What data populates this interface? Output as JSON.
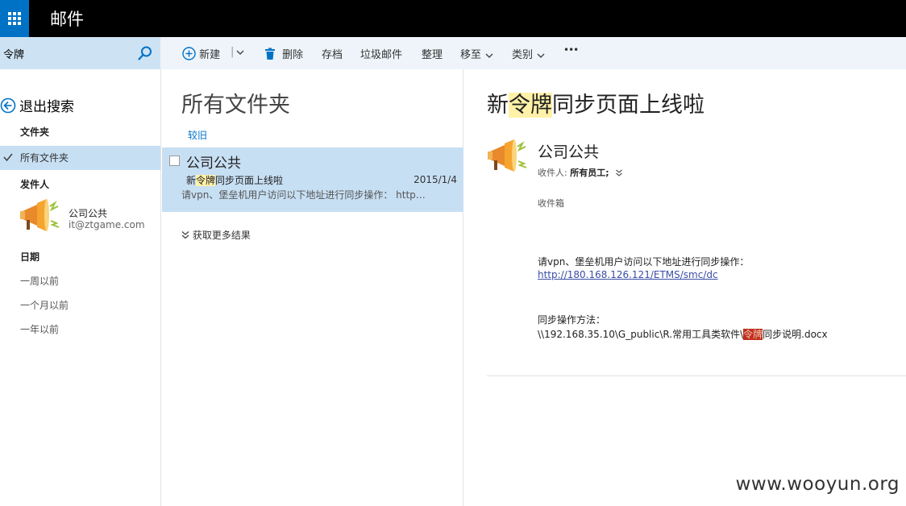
{
  "app": {
    "title": "邮件"
  },
  "search": {
    "value": "令牌"
  },
  "toolbar": {
    "new_label": "新建",
    "delete_label": "删除",
    "archive_label": "存档",
    "junk_label": "垃圾邮件",
    "sweep_label": "整理",
    "move_label": "移至",
    "category_label": "类别",
    "more_label": "•••"
  },
  "sidebar": {
    "back_label": "退出搜索",
    "folder_heading": "文件夹",
    "folder_selected": "所有文件夹",
    "sender_heading": "发件人",
    "sender_name": "公司公共",
    "sender_email": "it@ztgame.com",
    "date_heading": "日期",
    "date_items": [
      "一周以前",
      "一个月以前",
      "一年以前"
    ]
  },
  "list": {
    "title": "所有文件夹",
    "sort_label": "较旧",
    "message": {
      "sender": "公司公共",
      "subject_pre": "新",
      "subject_hl": "令牌",
      "subject_post": "同步页面上线啦",
      "date": "2015/1/4",
      "preview": "请vpn、堡垒机用户访问以下地址进行同步操作： http:..."
    },
    "more_results": "获取更多结果"
  },
  "reading": {
    "subject_pre": "新",
    "subject_hl": "令牌",
    "subject_post": "同步页面上线啦",
    "sender": "公司公共",
    "to_label": "收件人:",
    "to_value": "所有员工;",
    "folder": "收件箱",
    "body_line1": "请vpn、堡垒机用户访问以下地址进行同步操作：",
    "link": "http://180.168.126.121/ETMS/smc/dc",
    "body_line2": "同步操作方法：",
    "path_pre": "\\\\192.168.35.10\\G_public\\R.常用工具类软件\\",
    "path_hl": "令牌",
    "path_post": "同步说明.docx"
  },
  "watermark": "www.wooyun.org",
  "colors": {
    "accent": "#0072c6",
    "selection": "#c7dff3",
    "highlight": "#fff2a8"
  }
}
